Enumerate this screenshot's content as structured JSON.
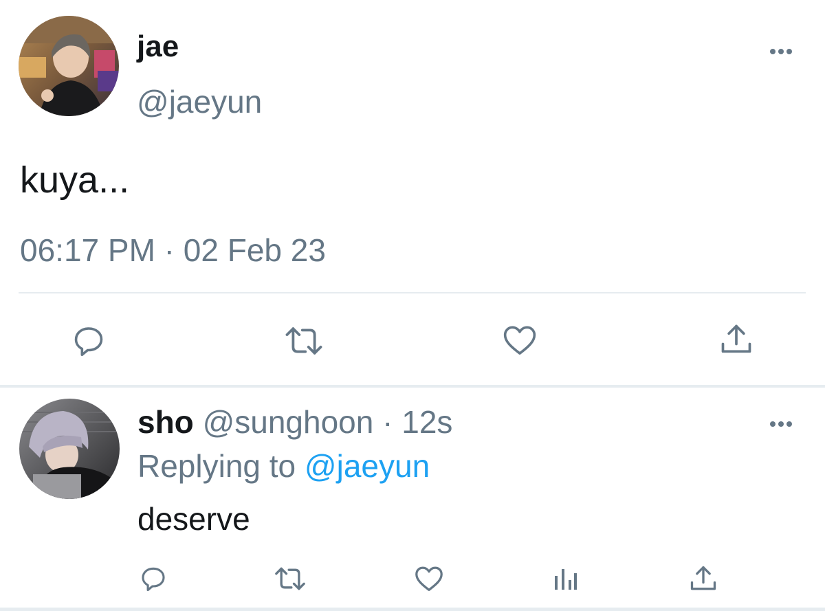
{
  "main_tweet": {
    "display_name": "jae",
    "handle": "@jaeyun",
    "text": "kuya...",
    "timestamp": "06:17 PM · 02 Feb 23",
    "actions": [
      "reply-icon",
      "retweet-icon",
      "like-icon",
      "share-icon"
    ]
  },
  "reply_tweet": {
    "display_name": "sho",
    "handle": "@sunghoon",
    "time_separator": "·",
    "relative_time": "12s",
    "replying_prefix": "Replying to",
    "replying_handle": "@jaeyun",
    "text": "deserve",
    "actions": [
      "reply-icon",
      "retweet-icon",
      "like-icon",
      "analytics-icon",
      "share-icon"
    ]
  },
  "colors": {
    "text": "#14171a",
    "muted": "#657786",
    "link": "#1da1f2",
    "divider": "#e6ecf0"
  }
}
